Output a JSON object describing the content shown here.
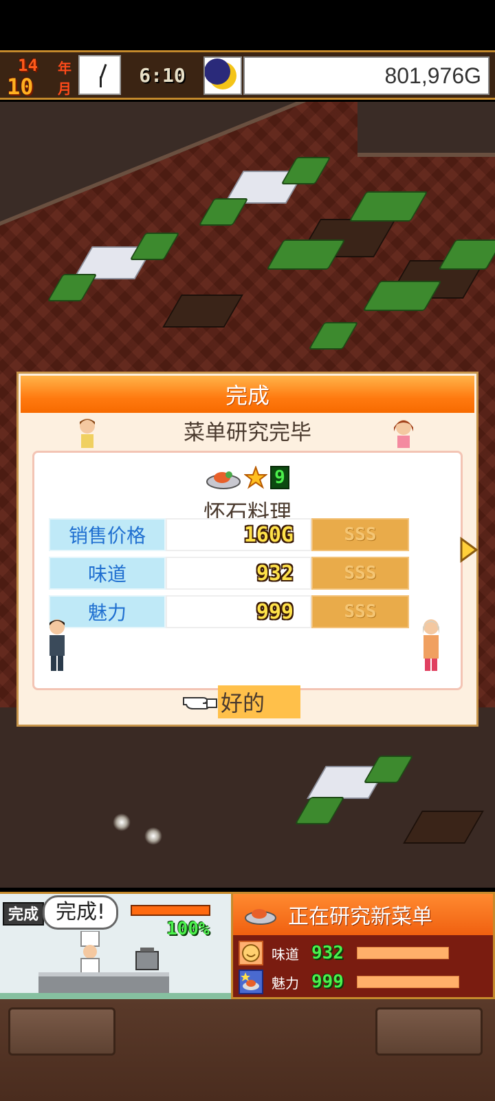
{
  "topbar": {
    "year": "14",
    "year_unit": "年",
    "month": "10",
    "month_unit": "月",
    "time": "6:10",
    "money": "801,976G",
    "clock_icon": "clock-icon",
    "moon_icon": "moon-icon"
  },
  "dialog": {
    "header": "完成",
    "subtitle": "菜单研究完毕",
    "dish_icon": "dish-icon",
    "star_icon": "star-icon",
    "dish_level": "9",
    "dish_name": "怀石料理",
    "stats": [
      {
        "label": "销售价格",
        "value": "160G",
        "rank": "SSS"
      },
      {
        "label": "味道",
        "value": "932",
        "rank": "SSS"
      },
      {
        "label": "魅力",
        "value": "999",
        "rank": "SSS"
      }
    ],
    "ok_label": "好的"
  },
  "kitchen": {
    "tag": "完成",
    "speech": "完成!",
    "progress_percent": 100,
    "progress_label": "100%"
  },
  "research": {
    "title": "正在研究新菜单",
    "rows": [
      {
        "label": "味道",
        "value": "932",
        "fill": 0.72
      },
      {
        "label": "魅力",
        "value": "999",
        "fill": 0.8
      }
    ]
  },
  "colors": {
    "header_orange": "#ff7a10",
    "stat_blue": "#1f6fd0",
    "rank_gold": "#e9ab4a",
    "value_green": "#4cf04c"
  }
}
